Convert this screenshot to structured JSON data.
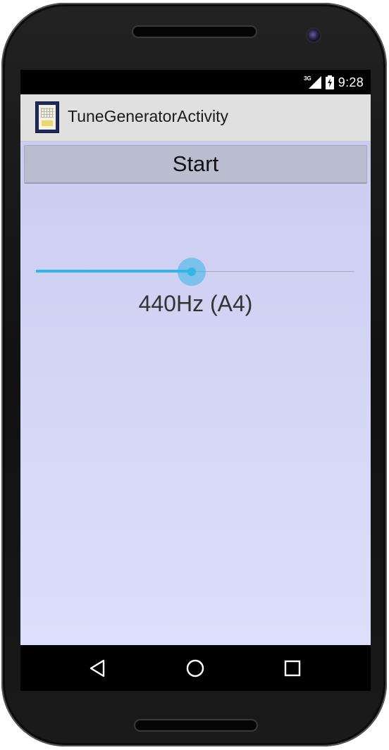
{
  "status_bar": {
    "network_type": "3G",
    "time": "9:28",
    "signal_icon": "signal-icon",
    "battery_icon": "battery-charging-icon"
  },
  "action_bar": {
    "title": "TuneGeneratorActivity",
    "app_icon": "app-icon"
  },
  "main": {
    "start_button_label": "Start",
    "frequency_label": "440Hz (A4)",
    "slider": {
      "value_fraction": 0.49,
      "accent_color": "#33b5e5"
    }
  },
  "nav_bar": {
    "back_icon": "back-icon",
    "home_icon": "home-icon",
    "recents_icon": "recents-icon"
  },
  "colors": {
    "action_bar_bg": "#e0e0e0",
    "content_bg_top": "#ccccf0",
    "content_bg_bottom": "#dcdefb",
    "button_bg": "#babccf",
    "accent": "#33b5e5"
  }
}
